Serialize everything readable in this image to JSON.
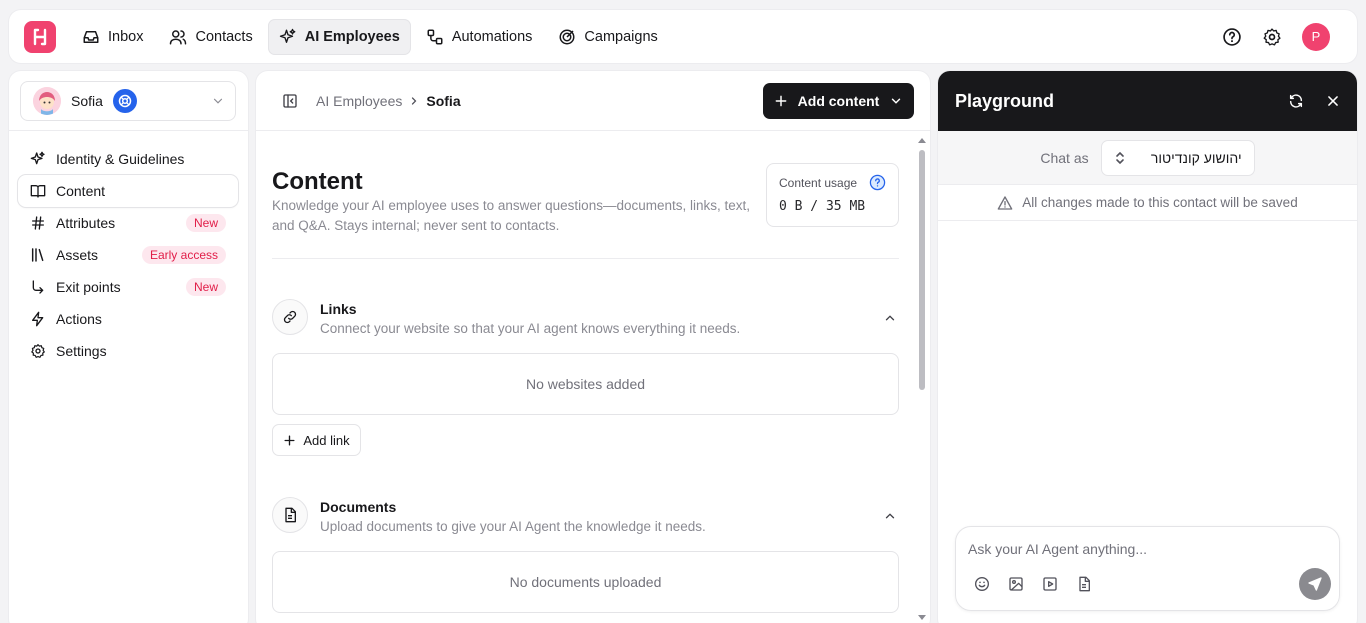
{
  "nav": {
    "items": [
      {
        "label": "Inbox"
      },
      {
        "label": "Contacts"
      },
      {
        "label": "AI Employees"
      },
      {
        "label": "Automations"
      },
      {
        "label": "Campaigns"
      }
    ],
    "active": "AI Employees",
    "user_initial": "P"
  },
  "sidebar": {
    "agent_name": "Sofia",
    "items": [
      {
        "label": "Identity & Guidelines",
        "icon": "sparkles-icon"
      },
      {
        "label": "Content",
        "icon": "book-icon"
      },
      {
        "label": "Attributes",
        "icon": "hash-icon",
        "badge": "New"
      },
      {
        "label": "Assets",
        "icon": "library-icon",
        "badge": "Early access"
      },
      {
        "label": "Exit points",
        "icon": "corner-arrow-icon",
        "badge": "New"
      },
      {
        "label": "Actions",
        "icon": "lightning-icon"
      },
      {
        "label": "Settings",
        "icon": "gear-icon"
      }
    ],
    "active": "Content"
  },
  "main": {
    "breadcrumb_parent": "AI Employees",
    "breadcrumb_current": "Sofia",
    "add_content_label": "Add content",
    "title": "Content",
    "description": "Knowledge your AI employee uses to answer questions—documents, links, text, and Q&A. Stays internal; never sent to contacts.",
    "usage_label": "Content usage",
    "usage_value": "0 B / 35 MB",
    "links": {
      "title": "Links",
      "description": "Connect your website so that your AI agent knows everything it needs.",
      "empty": "No websites added",
      "add_label": "Add link"
    },
    "documents": {
      "title": "Documents",
      "description": "Upload documents to give your AI Agent the knowledge it needs.",
      "empty": "No documents uploaded"
    }
  },
  "playground": {
    "title": "Playground",
    "chat_as_label": "Chat as",
    "chat_as_value": "יהושוע קונדיטור",
    "warning": "All changes made to this contact will be saved",
    "input_placeholder": "Ask your AI Agent anything..."
  },
  "colors": {
    "brand": "#f0426f",
    "dark": "#18181b",
    "badge_text": "#e11d48",
    "badge_bg": "#fde7ee"
  }
}
